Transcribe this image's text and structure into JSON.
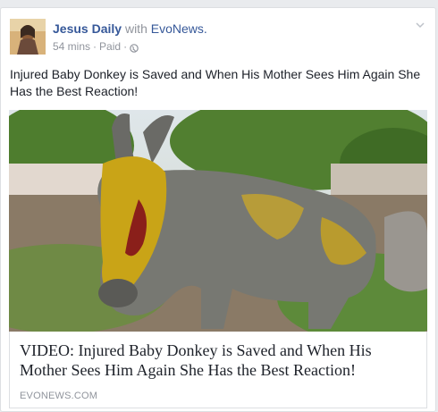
{
  "post": {
    "page_name": "Jesus Daily",
    "with_word": "with",
    "partner_name": "EvoNews.",
    "time": "54 mins",
    "separator": "·",
    "paid_label": "Paid",
    "privacy_icon": "globe-icon",
    "menu_icon": "chevron-down-icon",
    "text": "Injured Baby Donkey is Saved and When His Mother Sees Him Again She Has the Best Reaction!"
  },
  "link": {
    "title": "VIDEO: Injured Baby Donkey is Saved and When His Mother Sees Him Again She Has the Best Reaction!",
    "domain": "EVONEWS.COM"
  },
  "colors": {
    "link_blue": "#365899",
    "meta_gray": "#90949c",
    "background": "#e9ebee"
  }
}
